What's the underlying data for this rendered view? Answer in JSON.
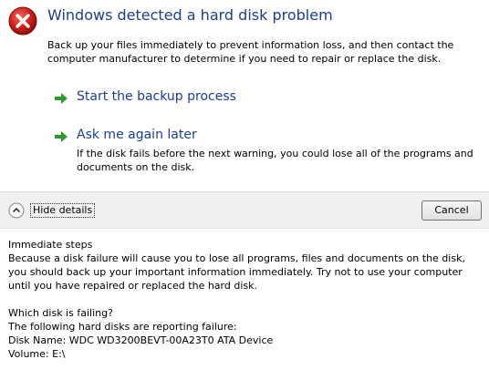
{
  "dialog": {
    "title": "Windows detected a hard disk problem",
    "description": "Back up your files immediately to prevent information loss, and then contact the computer manufacturer to determine if you need to repair or replace the disk."
  },
  "commands": [
    {
      "label": "Start the backup process",
      "icon": "green-arrow-icon"
    },
    {
      "label": "Ask me again later",
      "icon": "green-arrow-icon",
      "note": "If the disk fails before the next warning, you could lose all of the programs and documents on the disk."
    }
  ],
  "footer": {
    "toggle_label": "Hide details",
    "cancel_label": "Cancel"
  },
  "details": {
    "section1_heading": "Immediate steps",
    "section1_text": "Because a disk failure will cause you to lose all programs, files and documents on the disk, you should back up your important information immediately.  Try not to use your computer until you have repaired or replaced the hard disk.",
    "section2_heading": "Which disk is failing?",
    "section2_line1": "The following hard disks are reporting failure:",
    "disk_name": "Disk Name: WDC WD3200BEVT-00A23T0 ATA Device",
    "volume": "Volume: E:\\"
  },
  "colors": {
    "title_blue": "#1a3e96",
    "error_red": "#d0201b",
    "arrow_green": "#2e9a2e",
    "bar_gray": "#f0f0f0"
  }
}
